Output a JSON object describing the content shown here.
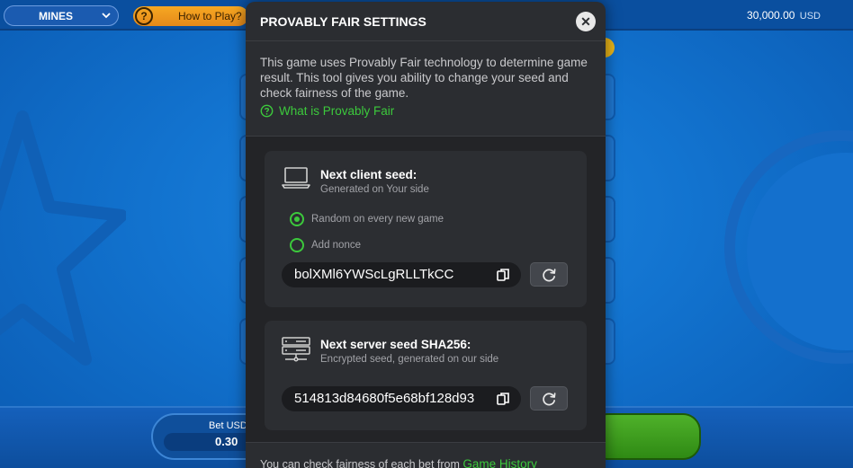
{
  "game": {
    "name": "MINES",
    "how_to_play": "How to Play?",
    "balance_amount": "30,000.00",
    "balance_currency": "USD",
    "bet_label": "Bet USD",
    "bet_value": "0.30"
  },
  "modal": {
    "title": "PROVABLY FAIR SETTINGS",
    "intro": "This game uses Provably Fair technology to determine game result. This tool gives you ability to change your seed and check fairness of the game.",
    "what_link": "What is Provably Fair",
    "client": {
      "title": "Next client seed:",
      "subtitle": "Generated on Your side",
      "option_random": "Random on every new game",
      "option_nonce": "Add nonce",
      "seed": "bolXMl6YWScLgRLLTkCC"
    },
    "server": {
      "title": "Next server seed SHA256:",
      "subtitle": "Encrypted seed, generated on our side",
      "seed": "514813d84680f5e68bf128d93"
    },
    "footer_text": "You can check fairness of each bet from",
    "footer_link": "Game History"
  },
  "colors": {
    "accent_green": "#3cc93c",
    "modal_bg": "#2b2d31",
    "game_blue": "#1273cf"
  }
}
